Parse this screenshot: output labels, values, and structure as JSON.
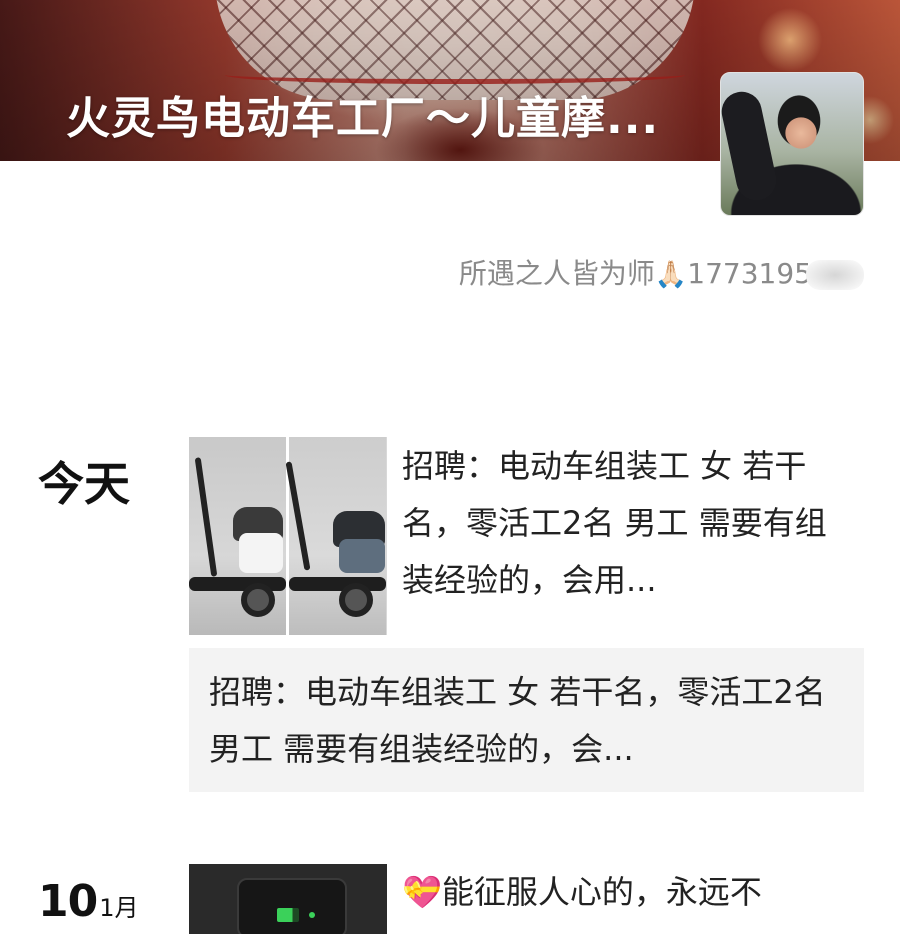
{
  "profile": {
    "cover_title": "火灵鸟电动车工厂～儿童摩...",
    "signature_text": "所遇之人皆为师",
    "signature_emoji": "🙏🏻",
    "signature_number": "1773195"
  },
  "feed": [
    {
      "date_label": "今天",
      "text": "招聘：电动车组装工 女 若干名，零活工2名 男工 需要有组装经验的，会用...",
      "share_text": "招聘：电动车组装工 女 若干名，零活工2名 男工 需要有组装经验的，会..."
    },
    {
      "date_day": "10",
      "date_month": "1月",
      "emoji": "💝",
      "text": "能征服人心的，永远不"
    }
  ]
}
